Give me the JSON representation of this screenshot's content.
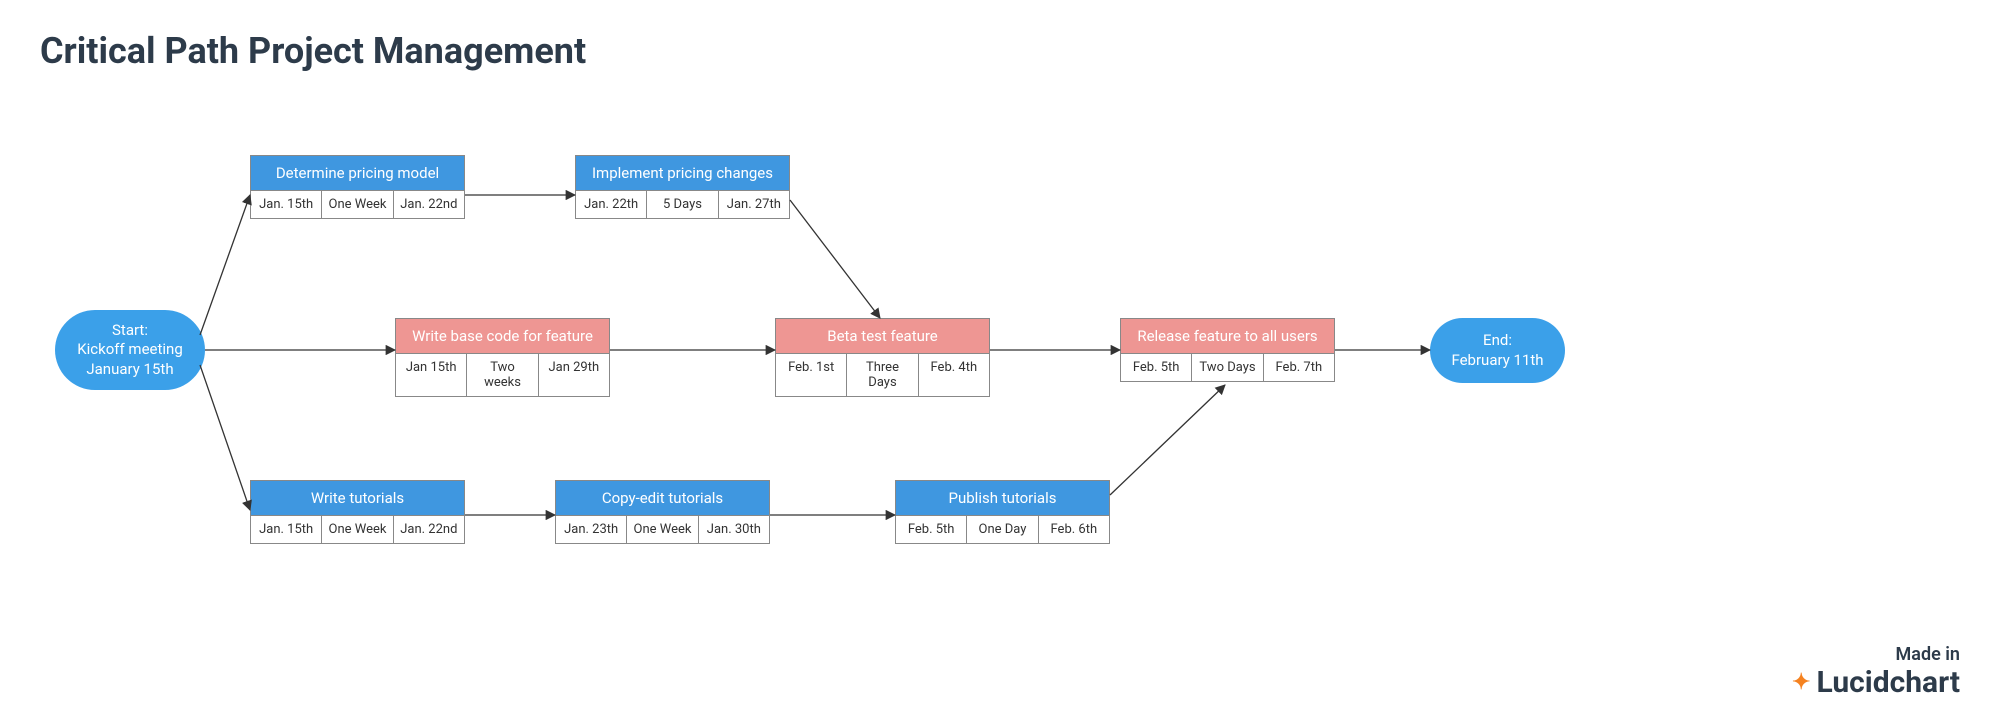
{
  "title": "Critical Path Project Management",
  "start_node": {
    "line1": "Start:",
    "line2": "Kickoff meeting",
    "line3": "January 15th"
  },
  "end_node": {
    "line1": "End:",
    "line2": "February 11th"
  },
  "tasks": {
    "pricing_model": {
      "label": "Determine pricing model",
      "start": "Jan. 15th",
      "dur": "One Week",
      "end": "Jan. 22nd",
      "color": "blue"
    },
    "pricing_changes": {
      "label": "Implement pricing changes",
      "start": "Jan. 22th",
      "dur": "5 Days",
      "end": "Jan. 27th",
      "color": "blue"
    },
    "base_code": {
      "label": "Write base code for feature",
      "start": "Jan 15th",
      "dur": "Two weeks",
      "end": "Jan 29th",
      "color": "pink"
    },
    "beta_test": {
      "label": "Beta test feature",
      "start": "Feb. 1st",
      "dur": "Three Days",
      "end": "Feb. 4th",
      "color": "pink"
    },
    "release": {
      "label": "Release feature to all users",
      "start": "Feb. 5th",
      "dur": "Two Days",
      "end": "Feb. 7th",
      "color": "pink"
    },
    "write_tut": {
      "label": "Write tutorials",
      "start": "Jan. 15th",
      "dur": "One Week",
      "end": "Jan. 22nd",
      "color": "blue"
    },
    "copy_tut": {
      "label": "Copy-edit tutorials",
      "start": "Jan. 23th",
      "dur": "One Week",
      "end": "Jan. 30th",
      "color": "blue"
    },
    "publish_tut": {
      "label": "Publish tutorials",
      "start": "Feb. 5th",
      "dur": "One Day",
      "end": "Feb. 6th",
      "color": "blue"
    }
  },
  "attribution": {
    "made": "Made in",
    "brand": "Lucidchart"
  },
  "chart_data": {
    "type": "flowchart",
    "title": "Critical Path Project Management",
    "nodes": [
      {
        "id": "start",
        "type": "terminal",
        "label": "Start: Kickoff meeting January 15th"
      },
      {
        "id": "pricing_model",
        "type": "task",
        "label": "Determine pricing model",
        "start": "Jan. 15th",
        "duration": "One Week",
        "end": "Jan. 22nd",
        "critical": false
      },
      {
        "id": "pricing_changes",
        "type": "task",
        "label": "Implement pricing changes",
        "start": "Jan. 22th",
        "duration": "5 Days",
        "end": "Jan. 27th",
        "critical": false
      },
      {
        "id": "base_code",
        "type": "task",
        "label": "Write base code for feature",
        "start": "Jan 15th",
        "duration": "Two weeks",
        "end": "Jan 29th",
        "critical": true
      },
      {
        "id": "beta_test",
        "type": "task",
        "label": "Beta test feature",
        "start": "Feb. 1st",
        "duration": "Three Days",
        "end": "Feb. 4th",
        "critical": true
      },
      {
        "id": "release",
        "type": "task",
        "label": "Release feature to all users",
        "start": "Feb. 5th",
        "duration": "Two Days",
        "end": "Feb. 7th",
        "critical": true
      },
      {
        "id": "write_tut",
        "type": "task",
        "label": "Write tutorials",
        "start": "Jan. 15th",
        "duration": "One Week",
        "end": "Jan. 22nd",
        "critical": false
      },
      {
        "id": "copy_tut",
        "type": "task",
        "label": "Copy-edit tutorials",
        "start": "Jan. 23th",
        "duration": "One Week",
        "end": "Jan. 30th",
        "critical": false
      },
      {
        "id": "publish_tut",
        "type": "task",
        "label": "Publish tutorials",
        "start": "Feb. 5th",
        "duration": "One Day",
        "end": "Feb. 6th",
        "critical": false
      },
      {
        "id": "end",
        "type": "terminal",
        "label": "End: February 11th"
      }
    ],
    "edges": [
      {
        "from": "start",
        "to": "pricing_model"
      },
      {
        "from": "start",
        "to": "base_code"
      },
      {
        "from": "start",
        "to": "write_tut"
      },
      {
        "from": "pricing_model",
        "to": "pricing_changes"
      },
      {
        "from": "pricing_changes",
        "to": "beta_test"
      },
      {
        "from": "base_code",
        "to": "beta_test"
      },
      {
        "from": "beta_test",
        "to": "release"
      },
      {
        "from": "write_tut",
        "to": "copy_tut"
      },
      {
        "from": "copy_tut",
        "to": "publish_tut"
      },
      {
        "from": "publish_tut",
        "to": "release"
      },
      {
        "from": "release",
        "to": "end"
      }
    ]
  }
}
